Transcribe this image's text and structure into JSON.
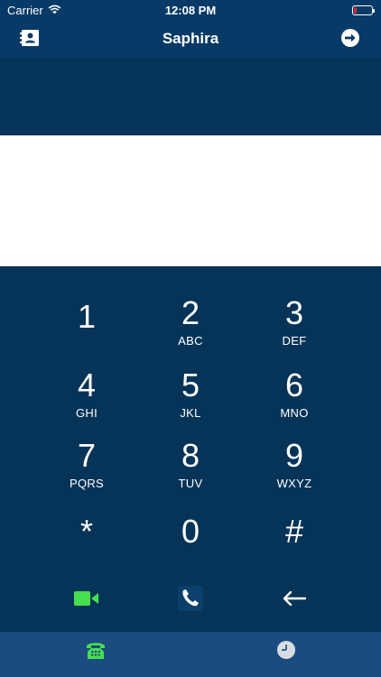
{
  "status_bar": {
    "carrier": "Carrier",
    "time": "12:08 PM",
    "icons": [
      "wifi-icon",
      "battery-icon"
    ],
    "battery_level": 0.15
  },
  "nav": {
    "title": "Saphira",
    "left_icon": "contacts-icon",
    "right_icon": "logout-icon"
  },
  "dialer": {
    "number_value": "",
    "keys": [
      {
        "digit": "1",
        "letters": ""
      },
      {
        "digit": "2",
        "letters": "ABC"
      },
      {
        "digit": "3",
        "letters": "DEF"
      },
      {
        "digit": "4",
        "letters": "GHI"
      },
      {
        "digit": "5",
        "letters": "JKL"
      },
      {
        "digit": "6",
        "letters": "MNO"
      },
      {
        "digit": "7",
        "letters": "PQRS"
      },
      {
        "digit": "8",
        "letters": "TUV"
      },
      {
        "digit": "9",
        "letters": "WXYZ"
      },
      {
        "digit": "*",
        "letters": ""
      },
      {
        "digit": "0",
        "letters": ""
      },
      {
        "digit": "#",
        "letters": ""
      }
    ],
    "actions": [
      "video-call-icon",
      "phone-call-icon",
      "backspace-arrow-icon"
    ]
  },
  "tabs": [
    {
      "icon": "telephone-icon",
      "active": true
    },
    {
      "icon": "clock-icon",
      "active": false
    }
  ],
  "colors": {
    "header": "#073a66",
    "keypad": "#063458",
    "tab_bar": "#1b4c7f",
    "accent_green": "#46e04f",
    "text": "#ffffff"
  }
}
